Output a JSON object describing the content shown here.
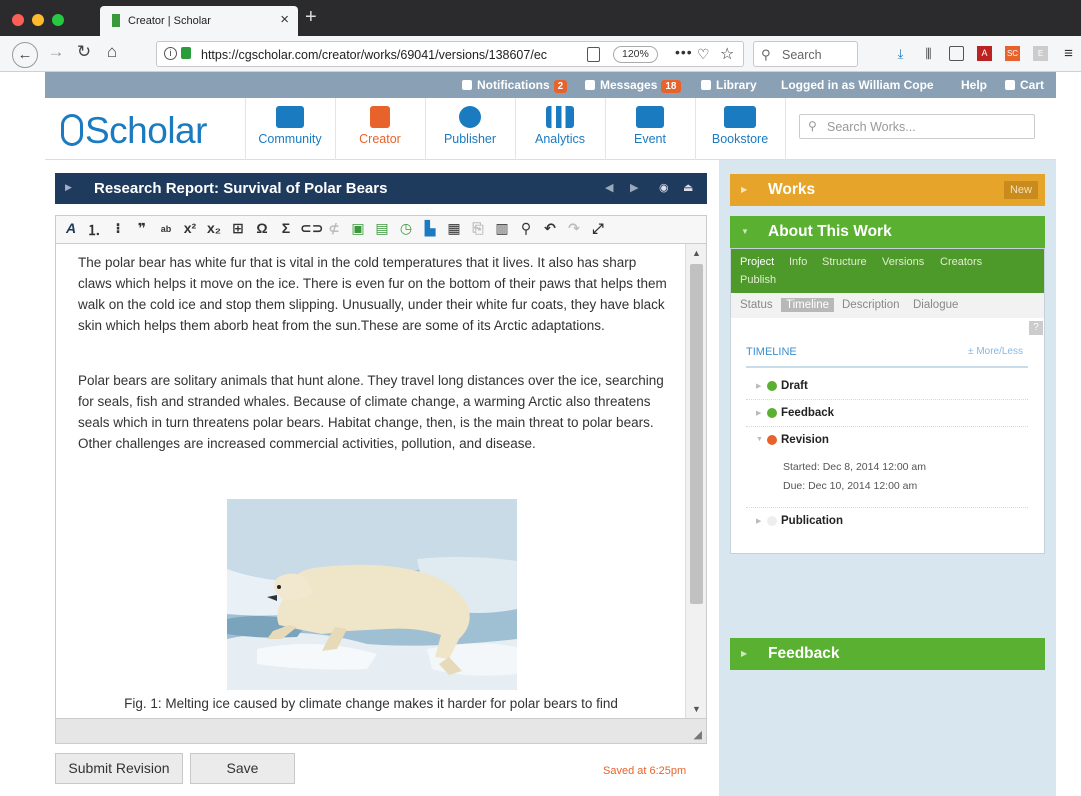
{
  "browser": {
    "tab_title": "Creator | Scholar",
    "tab_close": "×",
    "new_tab": "+",
    "url": "https://cgscholar.com/creator/works/69041/versions/138607/ec",
    "zoom": "120%",
    "search_placeholder": "Search"
  },
  "topbar": {
    "notifications_label": "Notifications",
    "notifications_count": "2",
    "messages_label": "Messages",
    "messages_count": "18",
    "library_label": "Library",
    "logged_in": "Logged in as William Cope",
    "help": "Help",
    "cart": "Cart"
  },
  "header": {
    "logo_text": "Scholar",
    "nav": {
      "community": "Community",
      "creator": "Creator",
      "publisher": "Publisher",
      "analytics": "Analytics",
      "event": "Event",
      "bookstore": "Bookstore"
    },
    "search_placeholder": "Search Works..."
  },
  "editor": {
    "doc_title": "Research Report: Survival of Polar Bears",
    "paragraph1": "The polar bear has white fur that is vital in the cold temperatures that it lives. It also has sharp claws which helps it move on the ice. There is even fur on the bottom of their paws that helps them walk on the cold ice and stop them slipping. Unusually, under their white fur coats, they have black skin which helps them aborb heat from the sun.These are some of its Arctic adaptations.",
    "paragraph2": "Polar bears are solitary animals that hunt alone. They travel long distances over the ice, searching for seals, fish and stranded whales. Because of climate change, a warming Arctic also threatens seals which in turn threatens polar bears. Habitat change, then, is the main threat to polar bears. Other challenges are increased commercial activities, pollution, and disease.",
    "caption": "Fig. 1: Melting ice caused by climate change makes it harder for polar bears to find",
    "submit_label": "Submit Revision",
    "save_label": "Save",
    "saved_status": "Saved at 6:25pm"
  },
  "sidebar": {
    "works_title": "Works",
    "new_label": "New",
    "about_title": "About This Work",
    "tabs": [
      "Project",
      "Info",
      "Structure",
      "Versions",
      "Creators",
      "Publish"
    ],
    "subtabs": [
      "Status",
      "Timeline",
      "Description",
      "Dialogue"
    ],
    "help": "?",
    "timeline_title": "TIMELINE",
    "more_less": "± More/Less",
    "timeline": {
      "draft": "Draft",
      "feedback": "Feedback",
      "revision": "Revision",
      "started": "Started: Dec 8, 2014 12:00 am",
      "due": "Due: Dec 10, 2014 12:00 am",
      "publication": "Publication"
    },
    "feedback_title": "Feedback"
  },
  "colors": {
    "brand_blue": "#1a7bc1",
    "creator_orange": "#e8632b",
    "works_gold": "#e6a42a",
    "about_green": "#5ab030",
    "doc_navy": "#1e3a5c"
  }
}
